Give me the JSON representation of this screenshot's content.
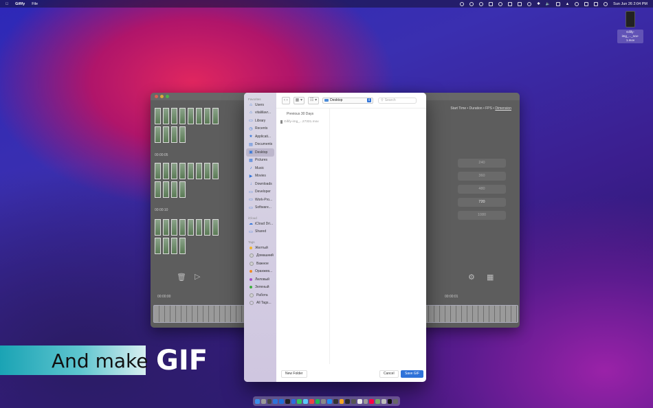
{
  "menubar": {
    "app_name": "Gifify",
    "menu_file": "File",
    "clock": "Sun Jun 26  2:04 PM"
  },
  "desktop_icon": {
    "label": "Gifify-img_..._nov-1.mov"
  },
  "app_window": {
    "header_info": "Start Time • Duration • FPS •",
    "header_dimension": "Dimension",
    "timecodes": [
      "00:00:05",
      "00:00:10"
    ],
    "dimension_options": [
      "240",
      "360",
      "480",
      "720",
      "1080"
    ],
    "selected_dimension": "720",
    "timeline_start": "00:00:00",
    "timeline_end": "00:00:01"
  },
  "dialog": {
    "sidebar": {
      "favorites_header": "Favorites",
      "favorites": [
        {
          "label": "Users",
          "icon": "home-icon"
        },
        {
          "label": "vitaliilavr...",
          "icon": "home-icon"
        },
        {
          "label": "Library",
          "icon": "folder-icon"
        },
        {
          "label": "Recents",
          "icon": "clock-icon"
        },
        {
          "label": "Applicati...",
          "icon": "apps-icon"
        },
        {
          "label": "Documents",
          "icon": "document-icon"
        },
        {
          "label": "Desktop",
          "icon": "desktop-icon"
        },
        {
          "label": "Pictures",
          "icon": "pictures-icon"
        },
        {
          "label": "Music",
          "icon": "music-icon"
        },
        {
          "label": "Movies",
          "icon": "movies-icon"
        },
        {
          "label": "Downloads",
          "icon": "download-icon"
        },
        {
          "label": "Developer",
          "icon": "folder-icon"
        },
        {
          "label": "Work-Pro...",
          "icon": "folder-icon"
        },
        {
          "label": "Software...",
          "icon": "folder-icon"
        }
      ],
      "selected": "Desktop",
      "icloud_header": "iCloud",
      "icloud": [
        {
          "label": "iCloud Dri...",
          "icon": "cloud-icon"
        },
        {
          "label": "Shared",
          "icon": "shared-folder-icon"
        }
      ],
      "tags_header": "Tags",
      "tags": [
        {
          "label": "Желтый",
          "color": "#f0b429"
        },
        {
          "label": "Домашний",
          "color": "#cfcfcf"
        },
        {
          "label": "Важное",
          "color": "#cfcfcf"
        },
        {
          "label": "Оранжев...",
          "color": "#f08a24"
        },
        {
          "label": "Лиловый",
          "color": "#a34fc7"
        },
        {
          "label": "Зеленый",
          "color": "#3cae3c"
        },
        {
          "label": "Работа",
          "color": "#cfcfcf"
        },
        {
          "label": "All Tags...",
          "color": "none"
        }
      ]
    },
    "location": "Desktop",
    "search_placeholder": "Search",
    "section_label": "Previous 30 Days",
    "file_name": "Gifify-img_...27331.mov",
    "new_folder_label": "New Folder",
    "cancel_label": "Cancel",
    "save_label": "Save GIF"
  },
  "promo": {
    "text": "And make",
    "highlight": "GIF"
  }
}
